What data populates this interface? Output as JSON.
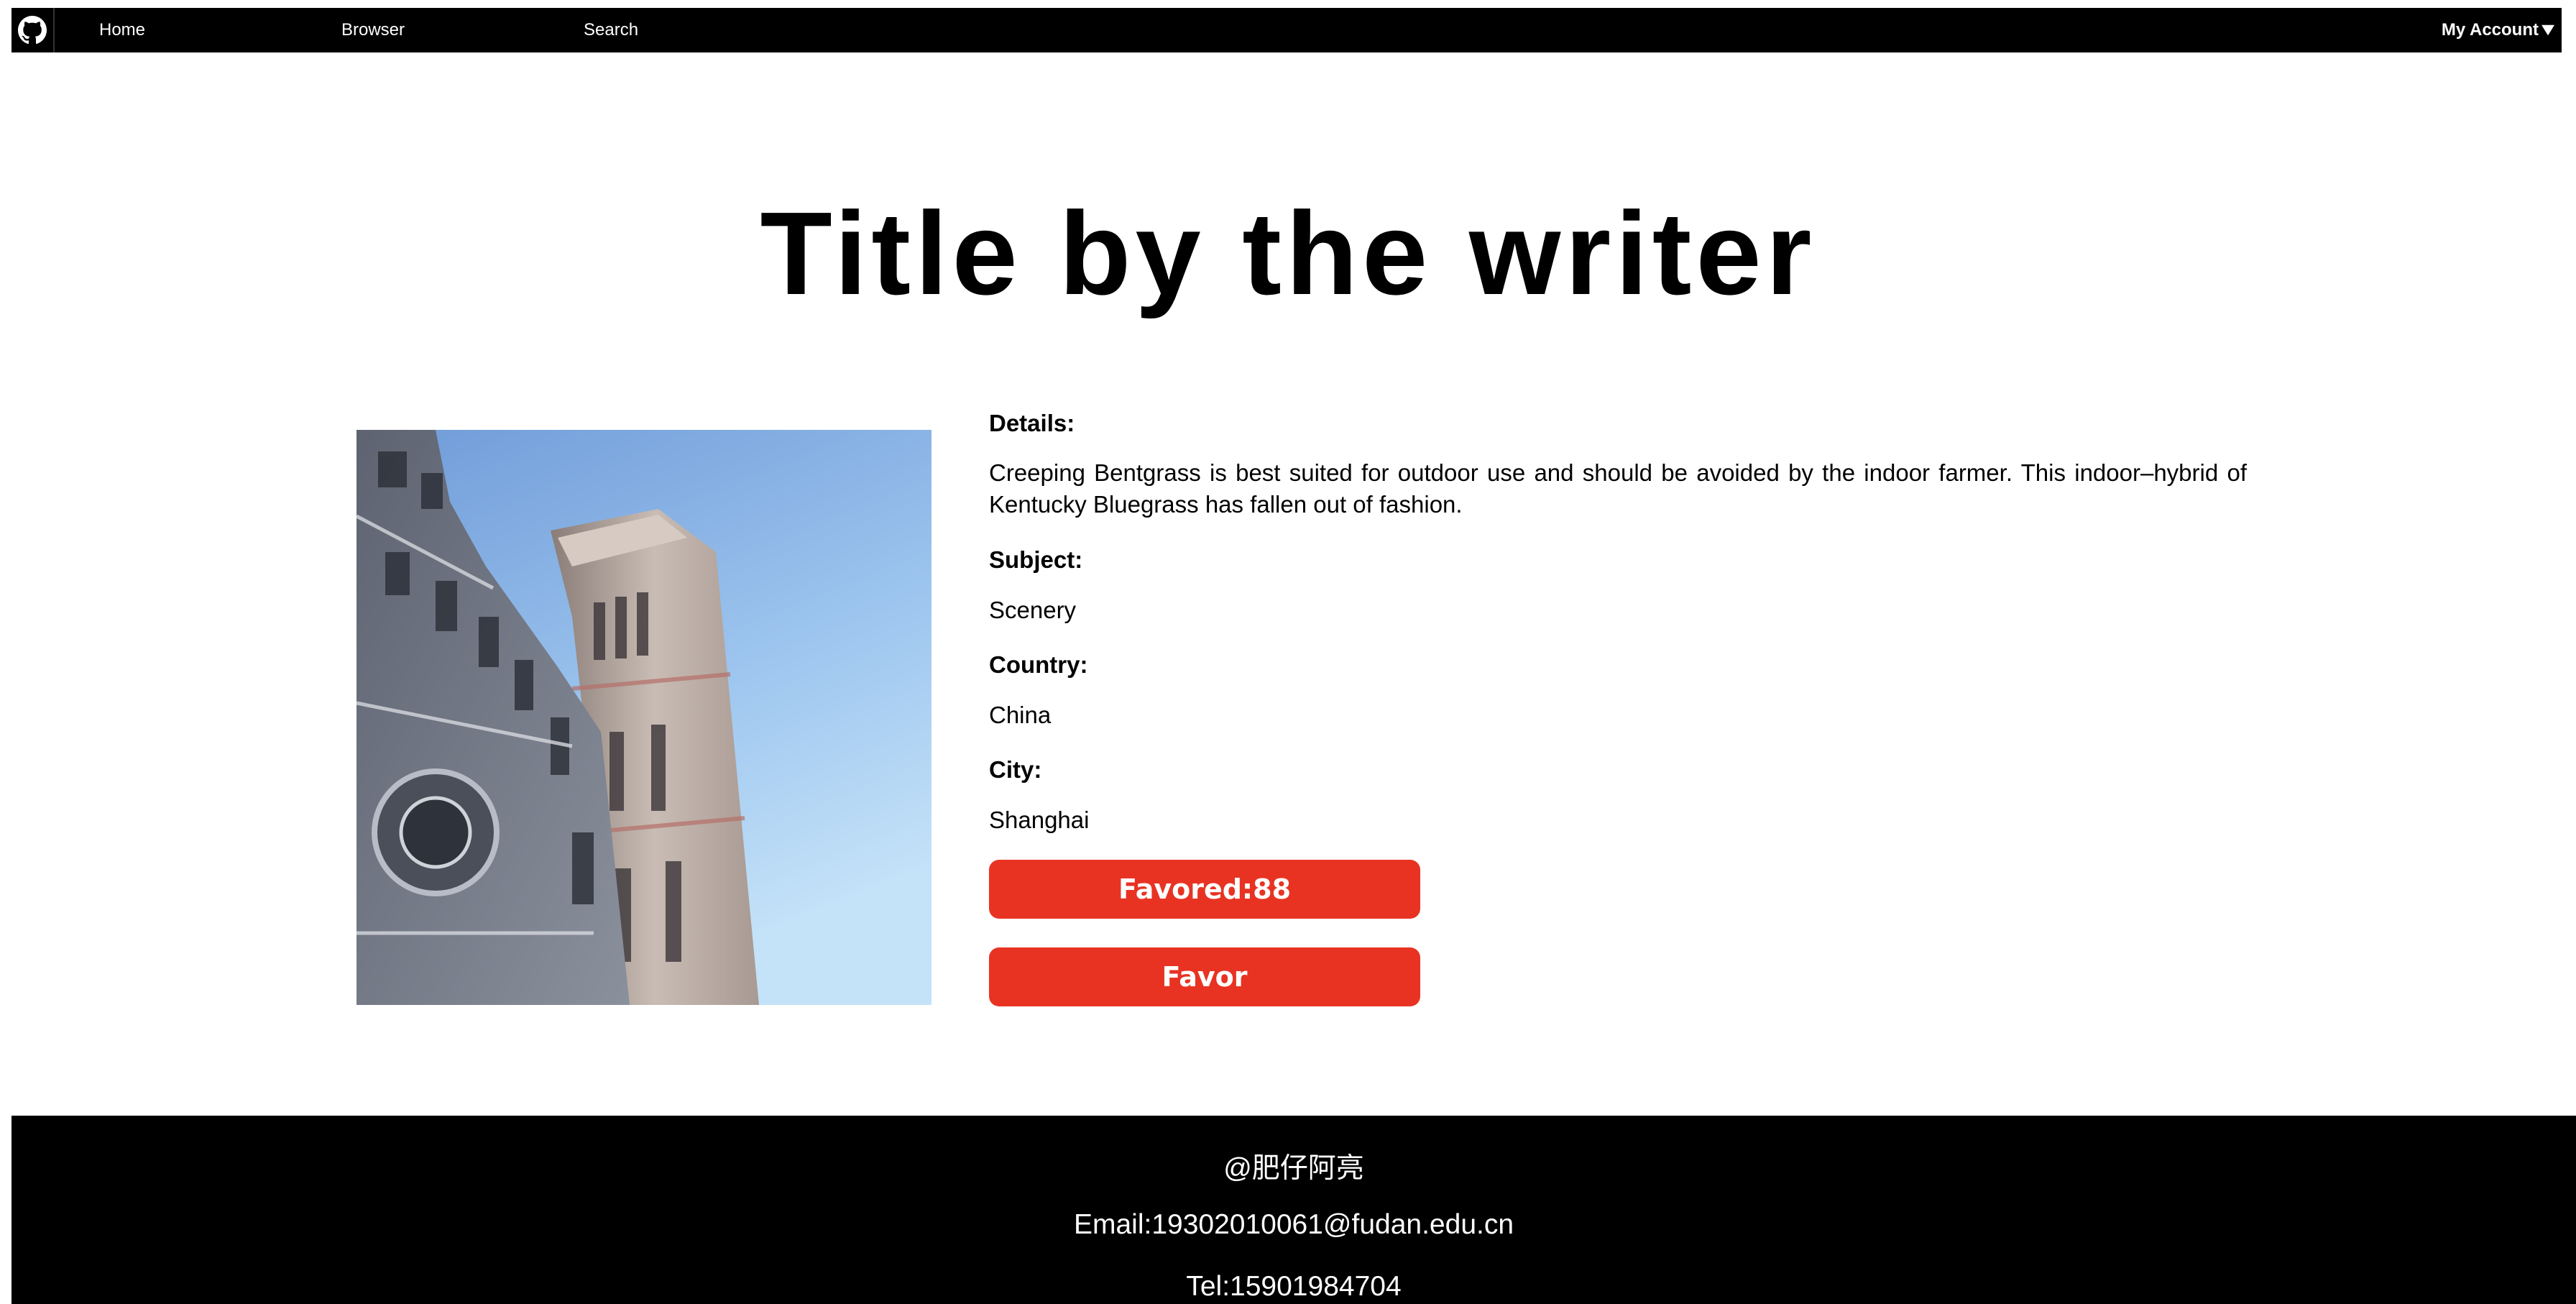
{
  "nav": {
    "logo_icon": "github-icon",
    "items": [
      {
        "label": "Home"
      },
      {
        "label": "Browser"
      },
      {
        "label": "Search"
      }
    ],
    "account_label": "My Account",
    "account_icon": "caret-down-icon"
  },
  "title": "Title by the writer",
  "photo": {
    "subject": "cathedral-bell-tower-photo"
  },
  "details": {
    "details_label": "Details:",
    "description": "Creeping Bentgrass is best suited for outdoor use and should be avoided by the indoor farmer. This indoor–hybrid of Kentucky Bluegrass has fallen out of fashion.",
    "subject_label": "Subject:",
    "subject_value": "Scenery",
    "country_label": "Country:",
    "country_value": "China",
    "city_label": "City:",
    "city_value": "Shanghai"
  },
  "buttons": {
    "favored_label": "Favored:88",
    "favor_label": "Favor"
  },
  "footer": {
    "author": "@肥仔阿亮",
    "email": "Email:19302010061@fudan.edu.cn",
    "tel": "Tel:15901984704"
  },
  "colors": {
    "accent": "#e83323",
    "nav_bg": "#000000",
    "footer_bg": "#000000"
  }
}
